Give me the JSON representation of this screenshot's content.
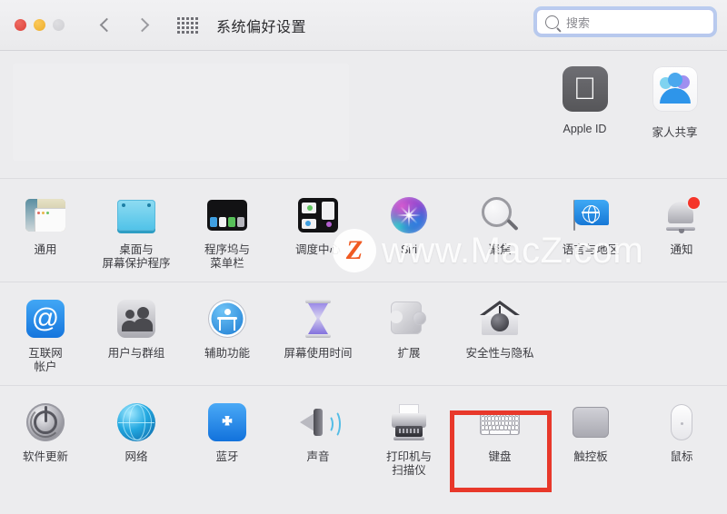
{
  "window": {
    "title": "系统偏好设置",
    "traffic_lights": [
      {
        "name": "close",
        "color": "#dc4038"
      },
      {
        "name": "minimize",
        "color": "#edad2b"
      },
      {
        "name": "zoom",
        "color": "#cfcfd3"
      }
    ],
    "back_label": "‹",
    "forward_label": "›",
    "show_all_label": "显示全部"
  },
  "search": {
    "placeholder": "搜索",
    "value": "",
    "focused": true,
    "focus_ring_color": "#78a0eb"
  },
  "banner": {
    "tiles": [
      {
        "label": "Apple ID",
        "icon": "apple-id-icon"
      },
      {
        "label": "家人共享",
        "icon": "family-sharing-icon"
      }
    ]
  },
  "sections": [
    {
      "name": "personal",
      "items": [
        {
          "label": "通用",
          "icon": "general-icon"
        },
        {
          "label": "桌面与\n屏幕保护程序",
          "icon": "desktop-screensaver-icon"
        },
        {
          "label": "程序坞与\n菜单栏",
          "icon": "dock-menubar-icon"
        },
        {
          "label": "调度中心",
          "icon": "mission-control-icon"
        },
        {
          "label": "Siri",
          "icon": "siri-icon"
        },
        {
          "label": "聚焦",
          "icon": "spotlight-icon"
        },
        {
          "label": "语言与地区",
          "icon": "language-region-icon"
        },
        {
          "label": "通知",
          "icon": "notifications-icon"
        }
      ]
    },
    {
      "name": "accounts",
      "items": [
        {
          "label": "互联网\n帐户",
          "icon": "internet-accounts-icon"
        },
        {
          "label": "用户与群组",
          "icon": "users-groups-icon"
        },
        {
          "label": "辅助功能",
          "icon": "accessibility-icon"
        },
        {
          "label": "屏幕使用时间",
          "icon": "screen-time-icon"
        },
        {
          "label": "扩展",
          "icon": "extensions-icon"
        },
        {
          "label": "安全性与隐私",
          "icon": "security-privacy-icon"
        }
      ]
    },
    {
      "name": "hardware",
      "items": [
        {
          "label": "软件更新",
          "icon": "software-update-icon"
        },
        {
          "label": "网络",
          "icon": "network-icon"
        },
        {
          "label": "蓝牙",
          "icon": "bluetooth-icon"
        },
        {
          "label": "声音",
          "icon": "sound-icon"
        },
        {
          "label": "打印机与\n扫描仪",
          "icon": "printers-scanners-icon"
        },
        {
          "label": "键盘",
          "icon": "keyboard-icon",
          "highlighted": true
        },
        {
          "label": "触控板",
          "icon": "trackpad-icon"
        },
        {
          "label": "鼠标",
          "icon": "mouse-icon"
        }
      ]
    }
  ],
  "annotation": {
    "target_label": "键盘",
    "border_color": "#e8382a"
  },
  "watermark": {
    "logo_text": "Z",
    "text": "www.MacZ.com"
  }
}
